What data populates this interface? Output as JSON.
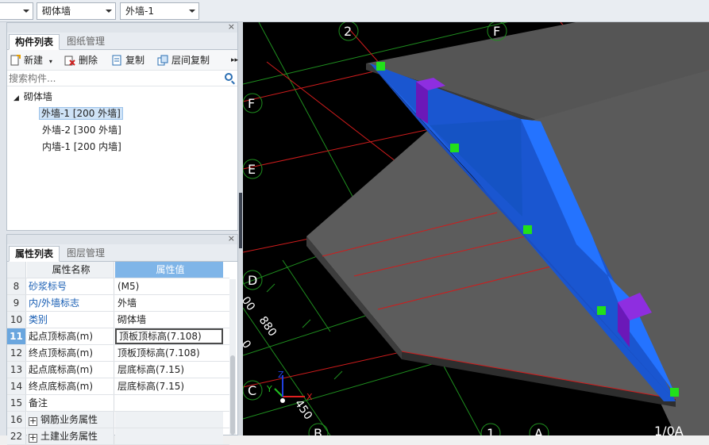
{
  "topbar": {
    "combo_empty": "",
    "combo_type": "砌体墙",
    "combo_member": "外墙-1"
  },
  "member_panel": {
    "tab_active": "构件列表",
    "tab_inactive": "图纸管理",
    "toolbar": {
      "new_label": "新建",
      "delete_label": "删除",
      "copy_label": "复制",
      "floor_copy_label": "层间复制"
    },
    "search_placeholder": "搜索构件...",
    "tree": {
      "root_label": "砌体墙",
      "items": [
        "外墙-1 [200 外墙]",
        "外墙-2 [300 外墙]",
        "内墙-1 [200 内墙]"
      ]
    }
  },
  "property_panel": {
    "tab_active": "属性列表",
    "tab_inactive": "图层管理",
    "header_name": "属性名称",
    "header_value": "属性值",
    "rows": [
      {
        "num": "8",
        "name": "砂浆标号",
        "value": "(M5)"
      },
      {
        "num": "9",
        "name": "内/外墙标志",
        "value": "外墙"
      },
      {
        "num": "10",
        "name": "类别",
        "value": "砌体墙"
      },
      {
        "num": "11",
        "name": "起点顶标高(m)",
        "value": "顶板顶标高(7.108)"
      },
      {
        "num": "12",
        "name": "终点顶标高(m)",
        "value": "顶板顶标高(7.108)"
      },
      {
        "num": "13",
        "name": "起点底标高(m)",
        "value": "层底标高(7.15)"
      },
      {
        "num": "14",
        "name": "终点底标高(m)",
        "value": "层底标高(7.15)"
      },
      {
        "num": "15",
        "name": "备注",
        "value": ""
      },
      {
        "num": "16",
        "name": "钢筋业务属性",
        "value": ""
      },
      {
        "num": "22",
        "name": "土建业务属性",
        "value": ""
      }
    ]
  },
  "viewport": {
    "axis_labels": {
      "top_2": "2",
      "top_F": "F",
      "left_F": "F",
      "left_E": "E",
      "left_D": "D",
      "left_C": "C",
      "bottom_B": "B",
      "bottom_1": "1",
      "bottom_A": "A",
      "bottom_1_0A": "1/0A"
    },
    "dimensions": {
      "d880": "880",
      "d450": "450",
      "d00a": "00",
      "d00b": "0"
    },
    "gizmo": {
      "x": "X",
      "y": "Y",
      "z": "Z"
    },
    "colors": {
      "wall_blue": "#1e62e6",
      "slab_gray": "#555555",
      "handle_green": "#22e01a",
      "grid_red": "#d01c1c",
      "grid_green": "#1f8f1f",
      "purple": "#7a20c8"
    }
  }
}
